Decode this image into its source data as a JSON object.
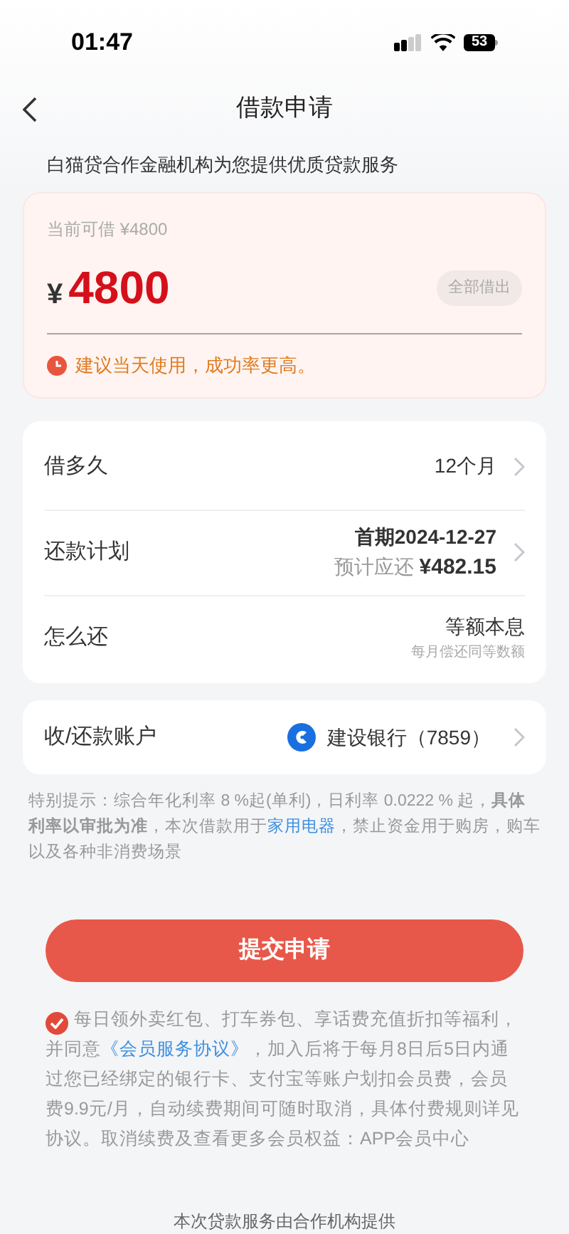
{
  "status_bar": {
    "time": "01:47",
    "battery": "53"
  },
  "header": {
    "title": "借款申请"
  },
  "subtitle": "白猫贷合作金融机构为您提供优质贷款服务",
  "amount_card": {
    "available": "当前可借 ¥4800",
    "currency": "¥",
    "amount": "4800",
    "all_button": "全部借出",
    "tip": "建议当天使用，成功率更高。"
  },
  "loan_rows": [
    {
      "kind": "simple",
      "label": "借多久",
      "value": "12个月"
    },
    {
      "kind": "plan",
      "label": "还款计划",
      "value": "首期2024-12-27",
      "sub_label": "预计应还",
      "sub_value": "¥482.15"
    },
    {
      "kind": "method",
      "label": "怎么还",
      "value": "等额本息",
      "sub_label": "每月偿还同等数额"
    }
  ],
  "account": {
    "label": "收/还款账户",
    "bank": "建设银行（7859）"
  },
  "notice": {
    "before": "特别提示：综合年化利率 8 %起(单利)，日利率 0.0222 % 起，**具体利率以审批为准**，本次借款用于",
    "link": "家用电器",
    "after": "，禁止资金用于购房，购车以及各种非消费场景"
  },
  "submit_button": "提交申请",
  "agreement": {
    "checked": true,
    "before": "每日领外卖红包、打车券包、享话费充值折扣等福利，并同意",
    "link": "《会员服务协议》",
    "after": "，加入后将于每月8日后5日内通过您已经绑定的银行卡、支付宝等账户划扣会员费，会员费9.9元/月，自动续费期间可随时取消，具体付费规则详见协议。取消续费及查看更多会员权益：APP会员中心"
  },
  "footer": "本次贷款服务由合作机构提供"
}
